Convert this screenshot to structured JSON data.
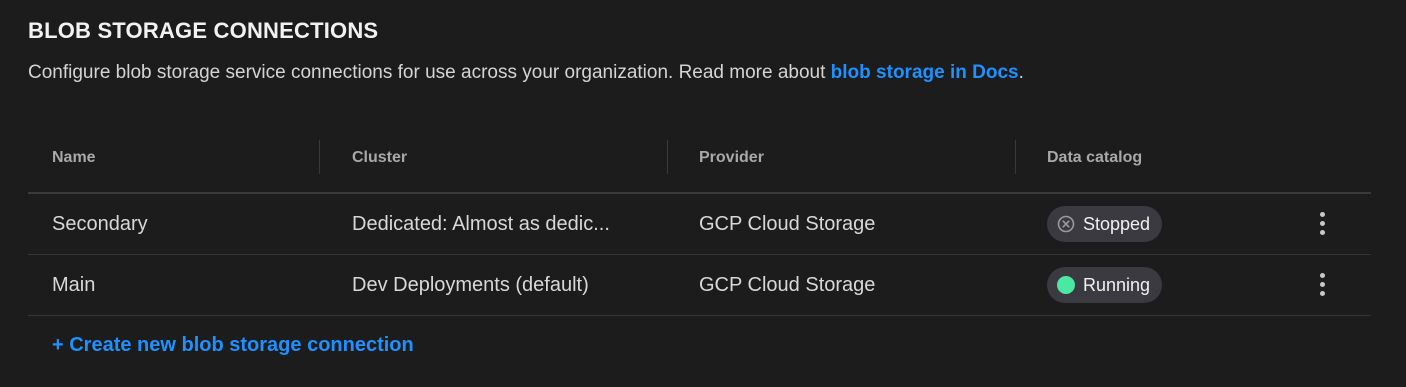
{
  "header": {
    "title": "BLOB STORAGE CONNECTIONS",
    "description_prefix": "Configure blob storage service connections for use across your organization. Read more about ",
    "docs_link": "blob storage in Docs",
    "description_suffix": "."
  },
  "table": {
    "columns": [
      "Name",
      "Cluster",
      "Provider",
      "Data catalog"
    ],
    "rows": [
      {
        "name": "Secondary",
        "cluster": "Dedicated:  Almost as dedic...",
        "provider": "GCP Cloud Storage",
        "status": "Stopped",
        "status_icon": "x-circle-icon"
      },
      {
        "name": "Main",
        "cluster": "Dev Deployments (default)",
        "provider": "GCP Cloud Storage",
        "status": "Running",
        "status_icon": "green-dot-icon"
      }
    ]
  },
  "actions": {
    "create_label": "+ Create new blob storage connection"
  },
  "colors": {
    "background": "#1c1c1c",
    "link": "#1e90ff",
    "running": "#4be8a4",
    "badge_bg": "#3a3a40"
  }
}
